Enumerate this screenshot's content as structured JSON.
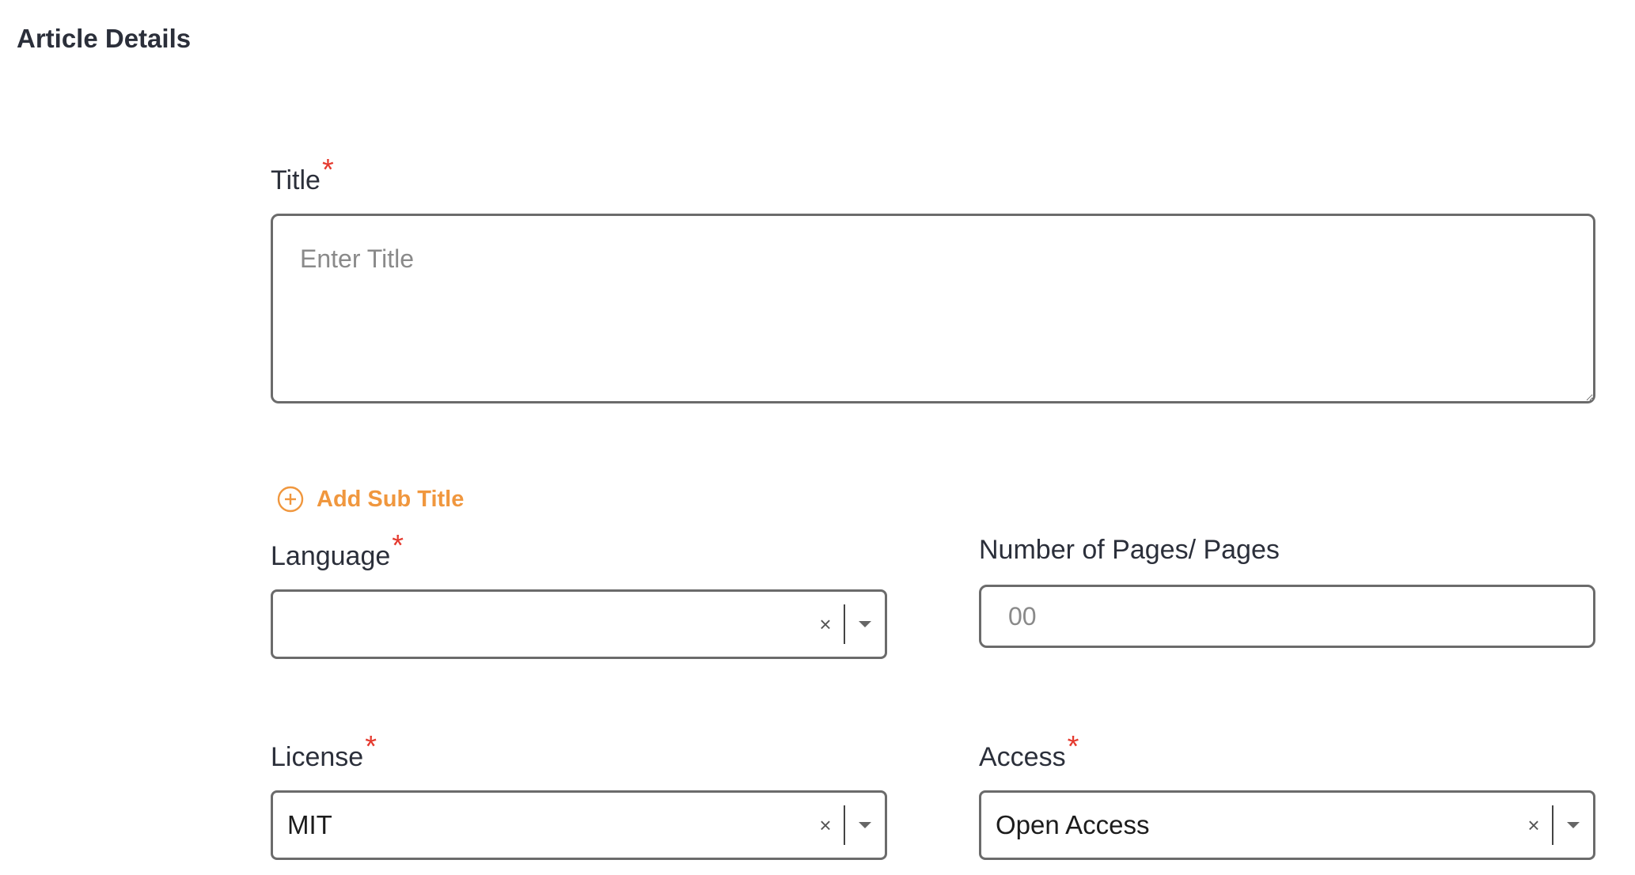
{
  "section": {
    "heading": "Article Details"
  },
  "form": {
    "title": {
      "label": "Title",
      "required_mark": "*",
      "placeholder": "Enter Title",
      "value": ""
    },
    "add_subtitle": {
      "label": "Add Sub Title",
      "icon": "plus-circle-icon"
    },
    "language": {
      "label": "Language",
      "required_mark": "*",
      "value": "",
      "clear_symbol": "×"
    },
    "pages": {
      "label": "Number of Pages/ Pages",
      "placeholder": "00",
      "value": ""
    },
    "license": {
      "label": "License",
      "required_mark": "*",
      "value": "MIT",
      "clear_symbol": "×"
    },
    "access": {
      "label": "Access",
      "required_mark": "*",
      "value": "Open Access",
      "clear_symbol": "×"
    }
  },
  "colors": {
    "accent": "#f0973e",
    "required": "#e53a2f",
    "border": "#6b6b6b",
    "text": "#2b2f3a"
  }
}
